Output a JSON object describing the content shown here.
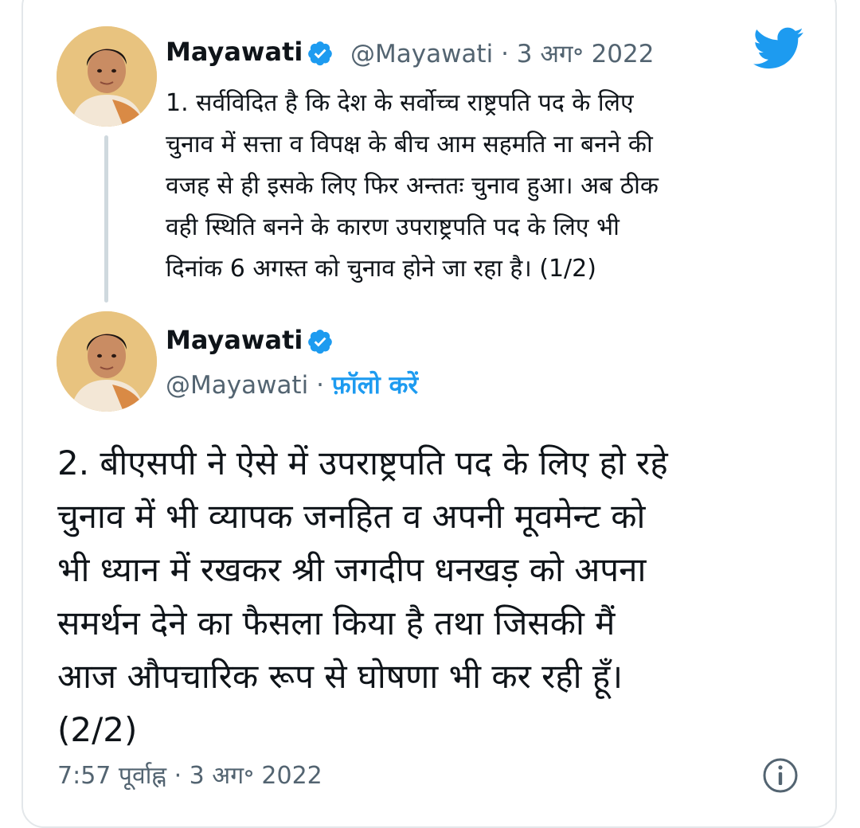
{
  "parent_tweet": {
    "name": "Mayawati",
    "handle": "@Mayawati",
    "separator": "·",
    "date": "3 अग॰ 2022",
    "lines": [
      "1. सर्वविदित है कि देश के सर्वोच्च राष्ट्रपति पद के लिए",
      "चुनाव में सत्ता व विपक्ष के बीच आम सहमति ना बनने की",
      "वजह से ही इसके लिए फिर अन्ततः चुनाव हुआ। अब ठीक",
      "वही स्थिति बनने के कारण उपराष्ट्रपति पद के लिए भी",
      "दिनांक 6 अगस्त को चुनाव होने जा रहा है। (1/2)"
    ]
  },
  "main_tweet": {
    "name": "Mayawati",
    "handle": "@Mayawati",
    "separator": "·",
    "follow_label": "फ़ॉलो करें",
    "lines": [
      "2. बीएसपी ने ऐसे में उपराष्ट्रपति पद के लिए हो रहे",
      "चुनाव में भी व्यापक जनहित व अपनी मूवमेन्ट को",
      "भी ध्यान में रखकर श्री जगदीप धनखड़ को अपना",
      "समर्थन देने का फैसला किया है तथा जिसकी मैं",
      "आज औपचारिक रूप से घोषणा भी कर रही हूँ।",
      "(2/2)"
    ],
    "timestamp": "7:57 पूर्वाह्न · 3 अग॰ 2022"
  },
  "icons": {
    "brand": "twitter-bird-icon",
    "verified": "verified-badge-icon",
    "info": "info-icon"
  },
  "colors": {
    "accent": "#1d9bf0",
    "text": "#0f1419",
    "muted": "#536471"
  }
}
